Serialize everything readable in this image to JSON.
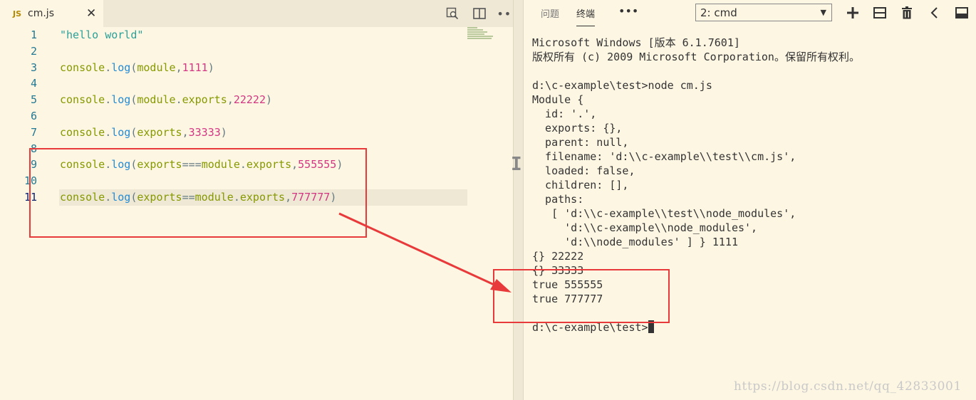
{
  "editor": {
    "tab": {
      "badge": "JS",
      "filename": "cm.js",
      "close_glyph": "✕"
    },
    "more_glyph": "•••",
    "lines": [
      {
        "n": "1",
        "parts": [
          {
            "t": "\"hello world\"",
            "c": "t-str"
          }
        ]
      },
      {
        "n": "2",
        "parts": []
      },
      {
        "n": "3",
        "parts": [
          {
            "t": "console",
            "c": "t-var"
          },
          {
            "t": ".",
            "c": "t-p"
          },
          {
            "t": "log",
            "c": "t-fn"
          },
          {
            "t": "(",
            "c": "t-p"
          },
          {
            "t": "module",
            "c": "t-var"
          },
          {
            "t": ",",
            "c": "t-p"
          },
          {
            "t": "1111",
            "c": "t-num"
          },
          {
            "t": ")",
            "c": "t-p"
          }
        ]
      },
      {
        "n": "4",
        "parts": []
      },
      {
        "n": "5",
        "parts": [
          {
            "t": "console",
            "c": "t-var"
          },
          {
            "t": ".",
            "c": "t-p"
          },
          {
            "t": "log",
            "c": "t-fn"
          },
          {
            "t": "(",
            "c": "t-p"
          },
          {
            "t": "module",
            "c": "t-var"
          },
          {
            "t": ".",
            "c": "t-p"
          },
          {
            "t": "exports",
            "c": "t-var"
          },
          {
            "t": ",",
            "c": "t-p"
          },
          {
            "t": "22222",
            "c": "t-num"
          },
          {
            "t": ")",
            "c": "t-p"
          }
        ]
      },
      {
        "n": "6",
        "parts": []
      },
      {
        "n": "7",
        "parts": [
          {
            "t": "console",
            "c": "t-var"
          },
          {
            "t": ".",
            "c": "t-p"
          },
          {
            "t": "log",
            "c": "t-fn"
          },
          {
            "t": "(",
            "c": "t-p"
          },
          {
            "t": "exports",
            "c": "t-var"
          },
          {
            "t": ",",
            "c": "t-p"
          },
          {
            "t": "33333",
            "c": "t-num"
          },
          {
            "t": ")",
            "c": "t-p"
          }
        ]
      },
      {
        "n": "8",
        "parts": []
      },
      {
        "n": "9",
        "parts": [
          {
            "t": "console",
            "c": "t-var"
          },
          {
            "t": ".",
            "c": "t-p"
          },
          {
            "t": "log",
            "c": "t-fn"
          },
          {
            "t": "(",
            "c": "t-p"
          },
          {
            "t": "exports",
            "c": "t-var"
          },
          {
            "t": "===",
            "c": "t-p"
          },
          {
            "t": "module",
            "c": "t-var"
          },
          {
            "t": ".",
            "c": "t-p"
          },
          {
            "t": "exports",
            "c": "t-var"
          },
          {
            "t": ",",
            "c": "t-p"
          },
          {
            "t": "555555",
            "c": "t-num"
          },
          {
            "t": ")",
            "c": "t-p"
          }
        ]
      },
      {
        "n": "10",
        "parts": []
      },
      {
        "n": "11",
        "current": true,
        "parts": [
          {
            "t": "console",
            "c": "t-var"
          },
          {
            "t": ".",
            "c": "t-p"
          },
          {
            "t": "log",
            "c": "t-fn"
          },
          {
            "t": "(",
            "c": "t-p"
          },
          {
            "t": "exports",
            "c": "t-var"
          },
          {
            "t": "==",
            "c": "t-p"
          },
          {
            "t": "module",
            "c": "t-var"
          },
          {
            "t": ".",
            "c": "t-p"
          },
          {
            "t": "exports",
            "c": "t-var"
          },
          {
            "t": ",",
            "c": "t-p"
          },
          {
            "t": "777777",
            "c": "t-num"
          },
          {
            "t": ")",
            "c": "t-p"
          }
        ]
      }
    ]
  },
  "panel": {
    "tabs": {
      "problems": "问题",
      "terminal": "终端"
    },
    "more_glyph": "•••",
    "terminal_select": "2: cmd",
    "select_arrow": "▼"
  },
  "terminal": {
    "lines": [
      "Microsoft Windows [版本 6.1.7601]",
      "版权所有 (c) 2009 Microsoft Corporation。保留所有权利。",
      "",
      "d:\\c-example\\test>node cm.js",
      "Module {",
      "  id: '.',",
      "  exports: {},",
      "  parent: null,",
      "  filename: 'd:\\\\c-example\\\\test\\\\cm.js',",
      "  loaded: false,",
      "  children: [],",
      "  paths:",
      "   [ 'd:\\\\c-example\\\\test\\\\node_modules',",
      "     'd:\\\\c-example\\\\node_modules',",
      "     'd:\\\\node_modules' ] } 1111",
      "{} 22222",
      "{} 33333",
      "true 555555",
      "true 777777",
      ""
    ],
    "prompt": "d:\\c-example\\test>"
  },
  "watermark": "https://blog.csdn.net/qq_42833001",
  "colors": {
    "annotation": "#e83a3a",
    "background": "#fdf6e3"
  }
}
